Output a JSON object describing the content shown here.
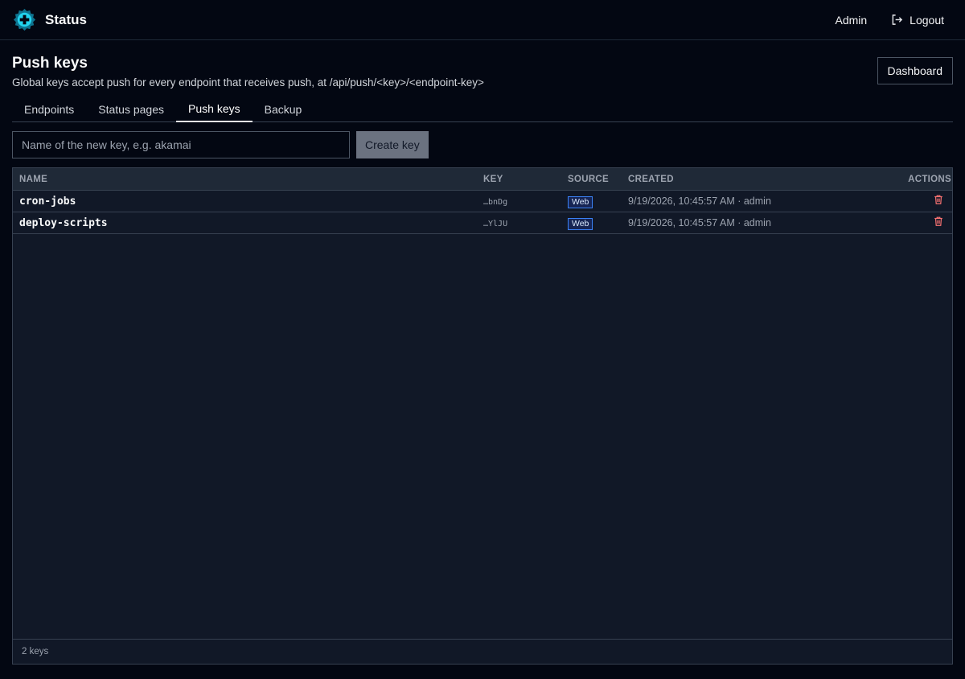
{
  "app": {
    "title": "Status"
  },
  "nav": {
    "user": "Admin",
    "logout_label": "Logout"
  },
  "page": {
    "title": "Push keys",
    "subtitle": "Global keys accept push for every endpoint that receives push, at /api/push/<key>/<endpoint-key>",
    "dashboard_label": "Dashboard"
  },
  "tabs": [
    {
      "label": "Endpoints",
      "active": false
    },
    {
      "label": "Status pages",
      "active": false
    },
    {
      "label": "Push keys",
      "active": true
    },
    {
      "label": "Backup",
      "active": false
    }
  ],
  "create": {
    "placeholder": "Name of the new key, e.g. akamai",
    "value": "",
    "button_label": "Create key"
  },
  "table": {
    "headers": {
      "name": "NAME",
      "key": "KEY",
      "source": "SOURCE",
      "created": "CREATED",
      "actions": "ACTIONS"
    },
    "rows": [
      {
        "name": "cron-jobs",
        "key": "…bnDg",
        "source": "Web",
        "created": "9/19/2026, 10:45:57 AM · admin",
        "action_icon": "trash-icon"
      },
      {
        "name": "deploy-scripts",
        "key": "…YlJU",
        "source": "Web",
        "created": "9/19/2026, 10:45:57 AM · admin",
        "action_icon": "trash-icon"
      }
    ],
    "footer": "2 keys"
  },
  "colors": {
    "background": "#030712",
    "panel": "#111827",
    "accent_logo": "#22d3ee",
    "delete": "#f87171",
    "badge_border": "#3b82f6"
  }
}
